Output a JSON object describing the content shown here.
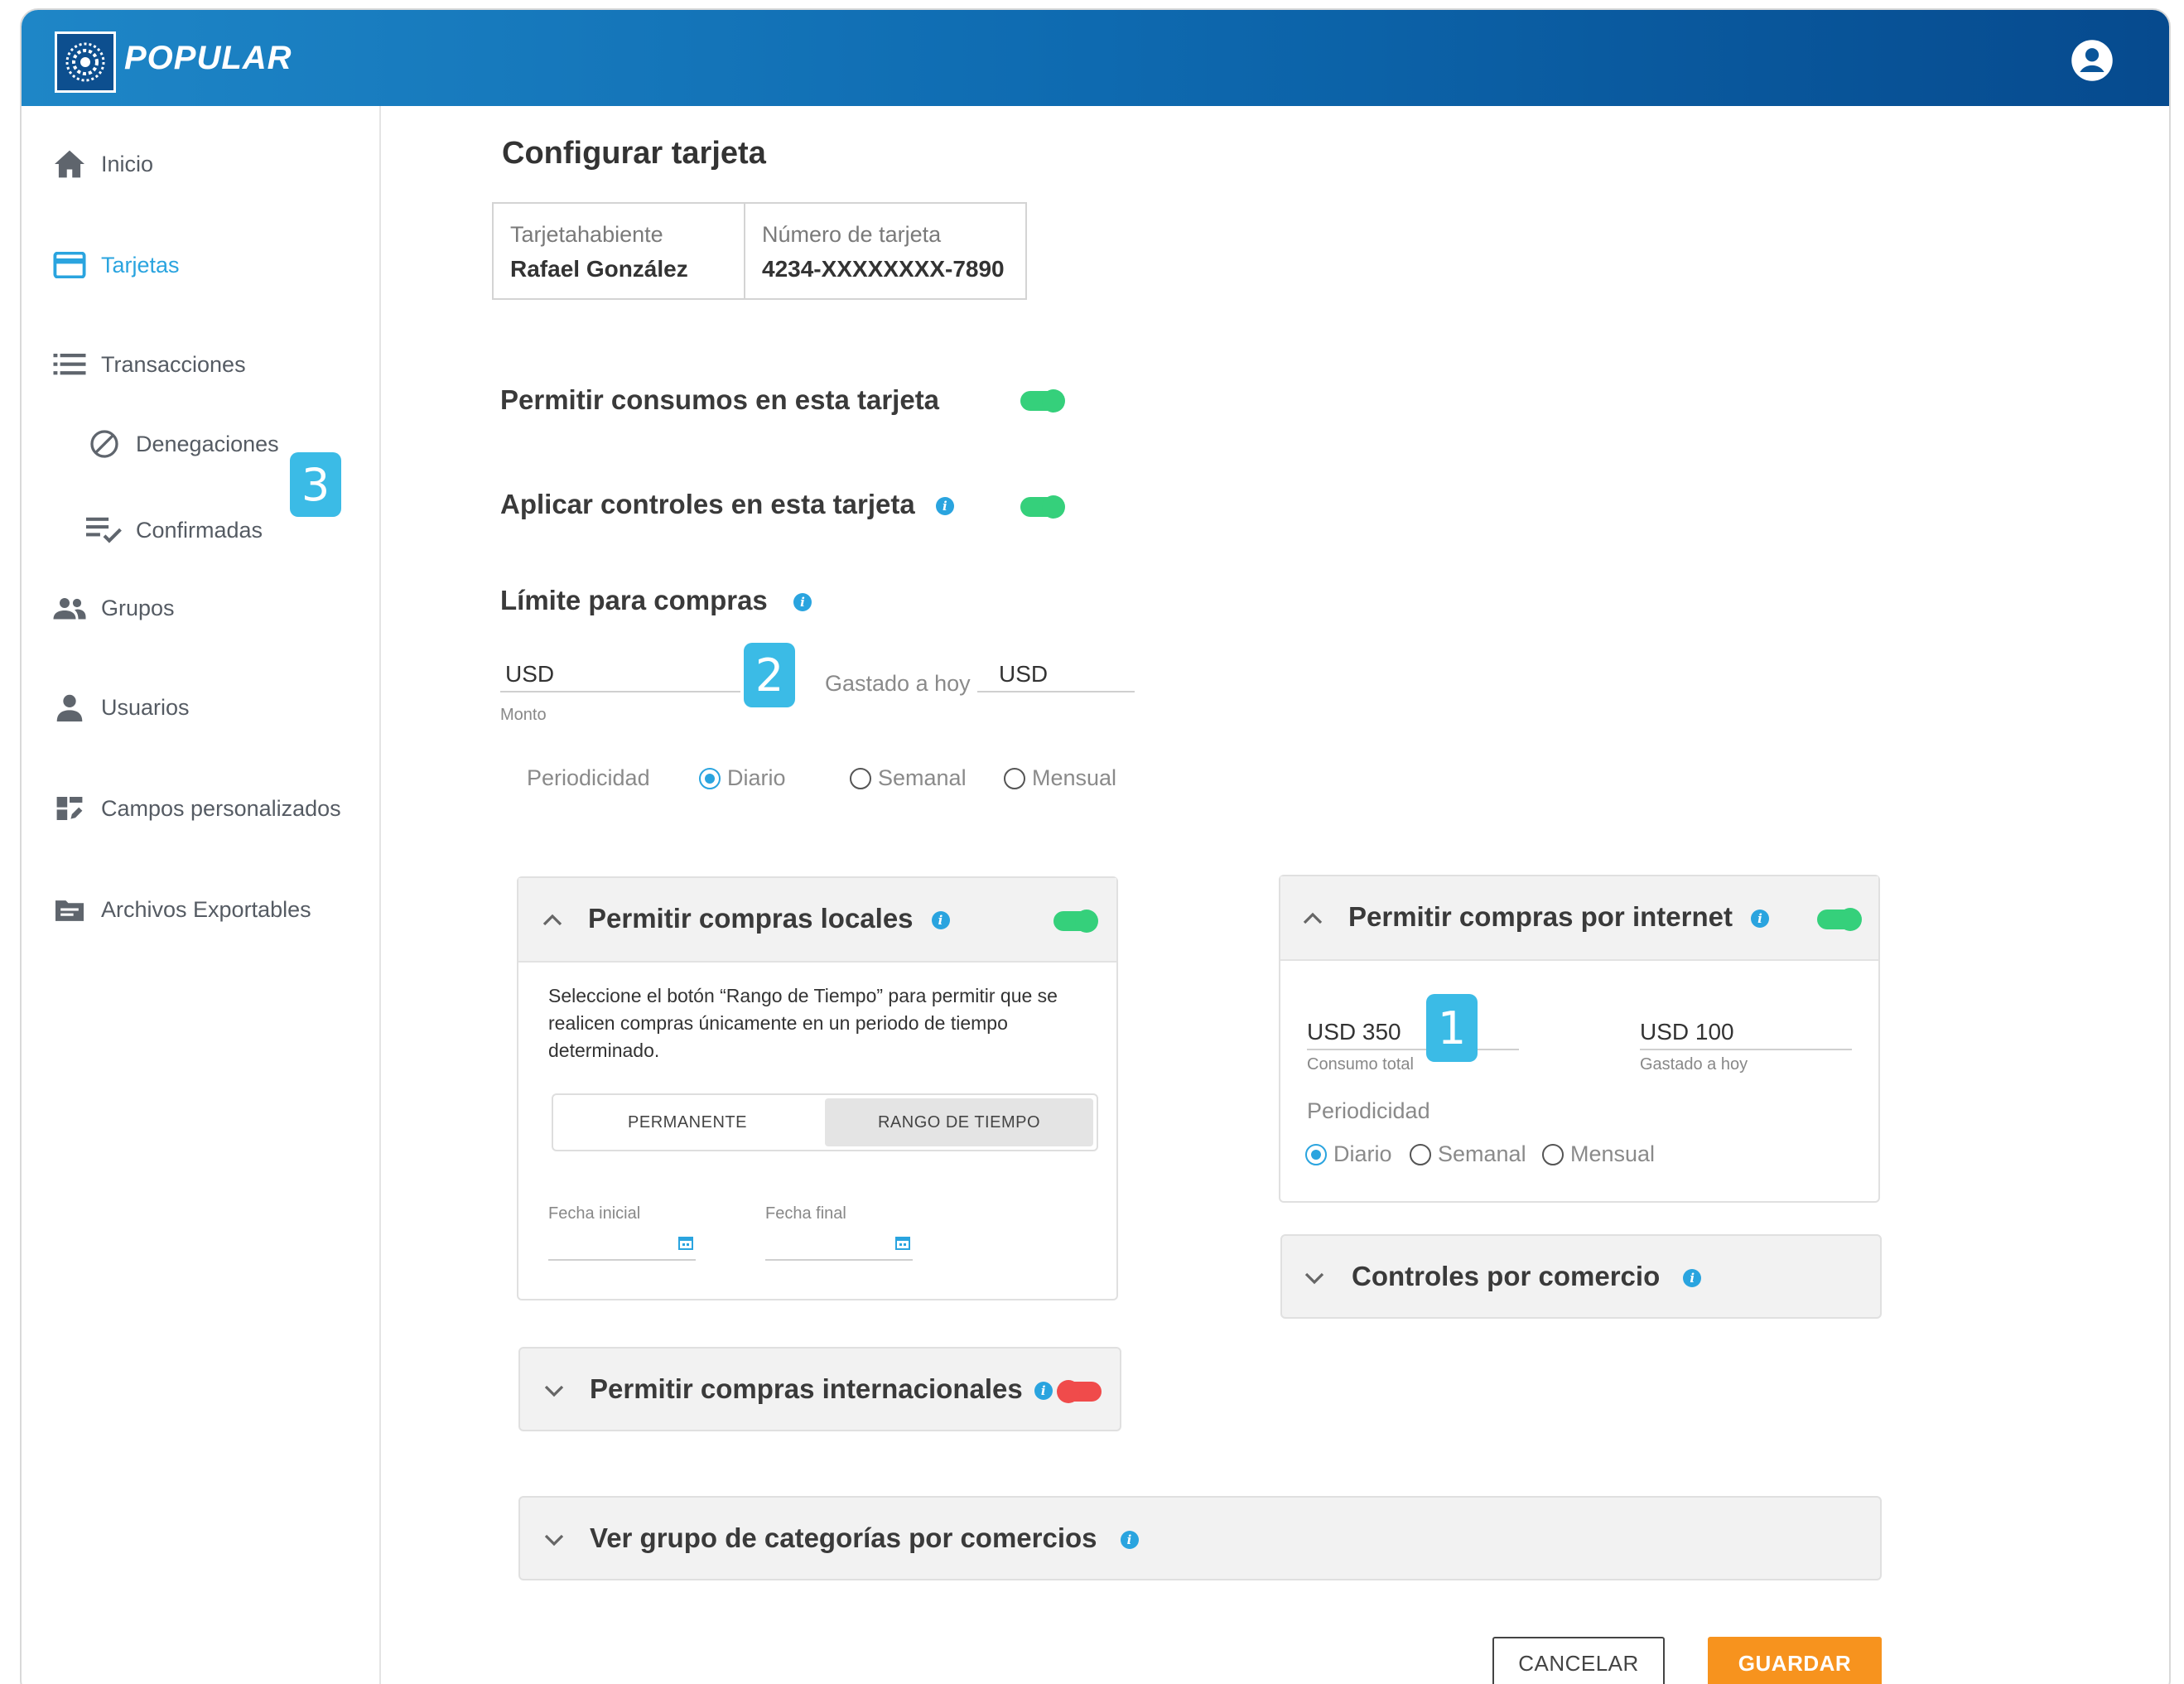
{
  "header": {
    "logo_text": "POPULAR"
  },
  "sidebar": {
    "items": [
      {
        "label": "Inicio",
        "icon": "home-icon"
      },
      {
        "label": "Tarjetas",
        "icon": "credit-card-icon"
      },
      {
        "label": "Transacciones",
        "icon": "list-icon"
      },
      {
        "label": "Denegaciones",
        "icon": "block-icon"
      },
      {
        "label": "Confirmadas",
        "icon": "playlist-check-icon"
      },
      {
        "label": "Grupos",
        "icon": "groups-icon"
      },
      {
        "label": "Usuarios",
        "icon": "user-icon"
      },
      {
        "label": "Campos personalizados",
        "icon": "dashboard-edit-icon"
      },
      {
        "label": "Archivos Exportables",
        "icon": "folder-icon"
      }
    ]
  },
  "badges": {
    "one": "1",
    "two": "2",
    "three": "3"
  },
  "page": {
    "title": "Configurar tarjeta",
    "cardholder_label": "Tarjetahabiente",
    "cardholder_value": "Rafael González",
    "card_number_label": "Número de tarjeta",
    "card_number_value": "4234-XXXXXXXX-7890",
    "allow_consumption": "Permitir consumos en esta tarjeta",
    "apply_controls": "Aplicar controles en esta tarjeta",
    "purchase_limit": "Límite para compras",
    "limit_currency": "USD",
    "limit_amount_label": "Monto",
    "spent_today_label": "Gastado a hoy",
    "spent_currency": "USD",
    "periodicity_label": "Periodicidad",
    "period_daily": "Diario",
    "period_weekly": "Semanal",
    "period_monthly": "Mensual"
  },
  "local_panel": {
    "title": "Permitir compras locales",
    "description": "Seleccione el botón “Rango de Tiempo” para permitir que se realicen compras únicamente en un periodo de tiempo determinado.",
    "seg_permanent": "PERMANENTE",
    "seg_range": "RANGO DE TIEMPO",
    "start_date_label": "Fecha inicial",
    "end_date_label": "Fecha final"
  },
  "internet_panel": {
    "title": "Permitir compras por internet",
    "total_value": "USD 350",
    "total_label": "Consumo total",
    "spent_value": "USD 100",
    "spent_label": "Gastado a hoy",
    "periodicity_label": "Periodicidad",
    "period_daily": "Diario",
    "period_weekly": "Semanal",
    "period_monthly": "Mensual"
  },
  "merchant_panel": {
    "title": "Controles por comercio"
  },
  "international_panel": {
    "title": "Permitir compras internacionales"
  },
  "categories_panel": {
    "title": "Ver grupo de categorías por comercios"
  },
  "actions": {
    "cancel": "CANCELAR",
    "save": "GUARDAR"
  },
  "colors": {
    "accent": "#2aa4df",
    "toggle_on": "#35d07b",
    "toggle_off": "#f04b4b",
    "save": "#f7931e",
    "badge": "#3bbbe6"
  }
}
